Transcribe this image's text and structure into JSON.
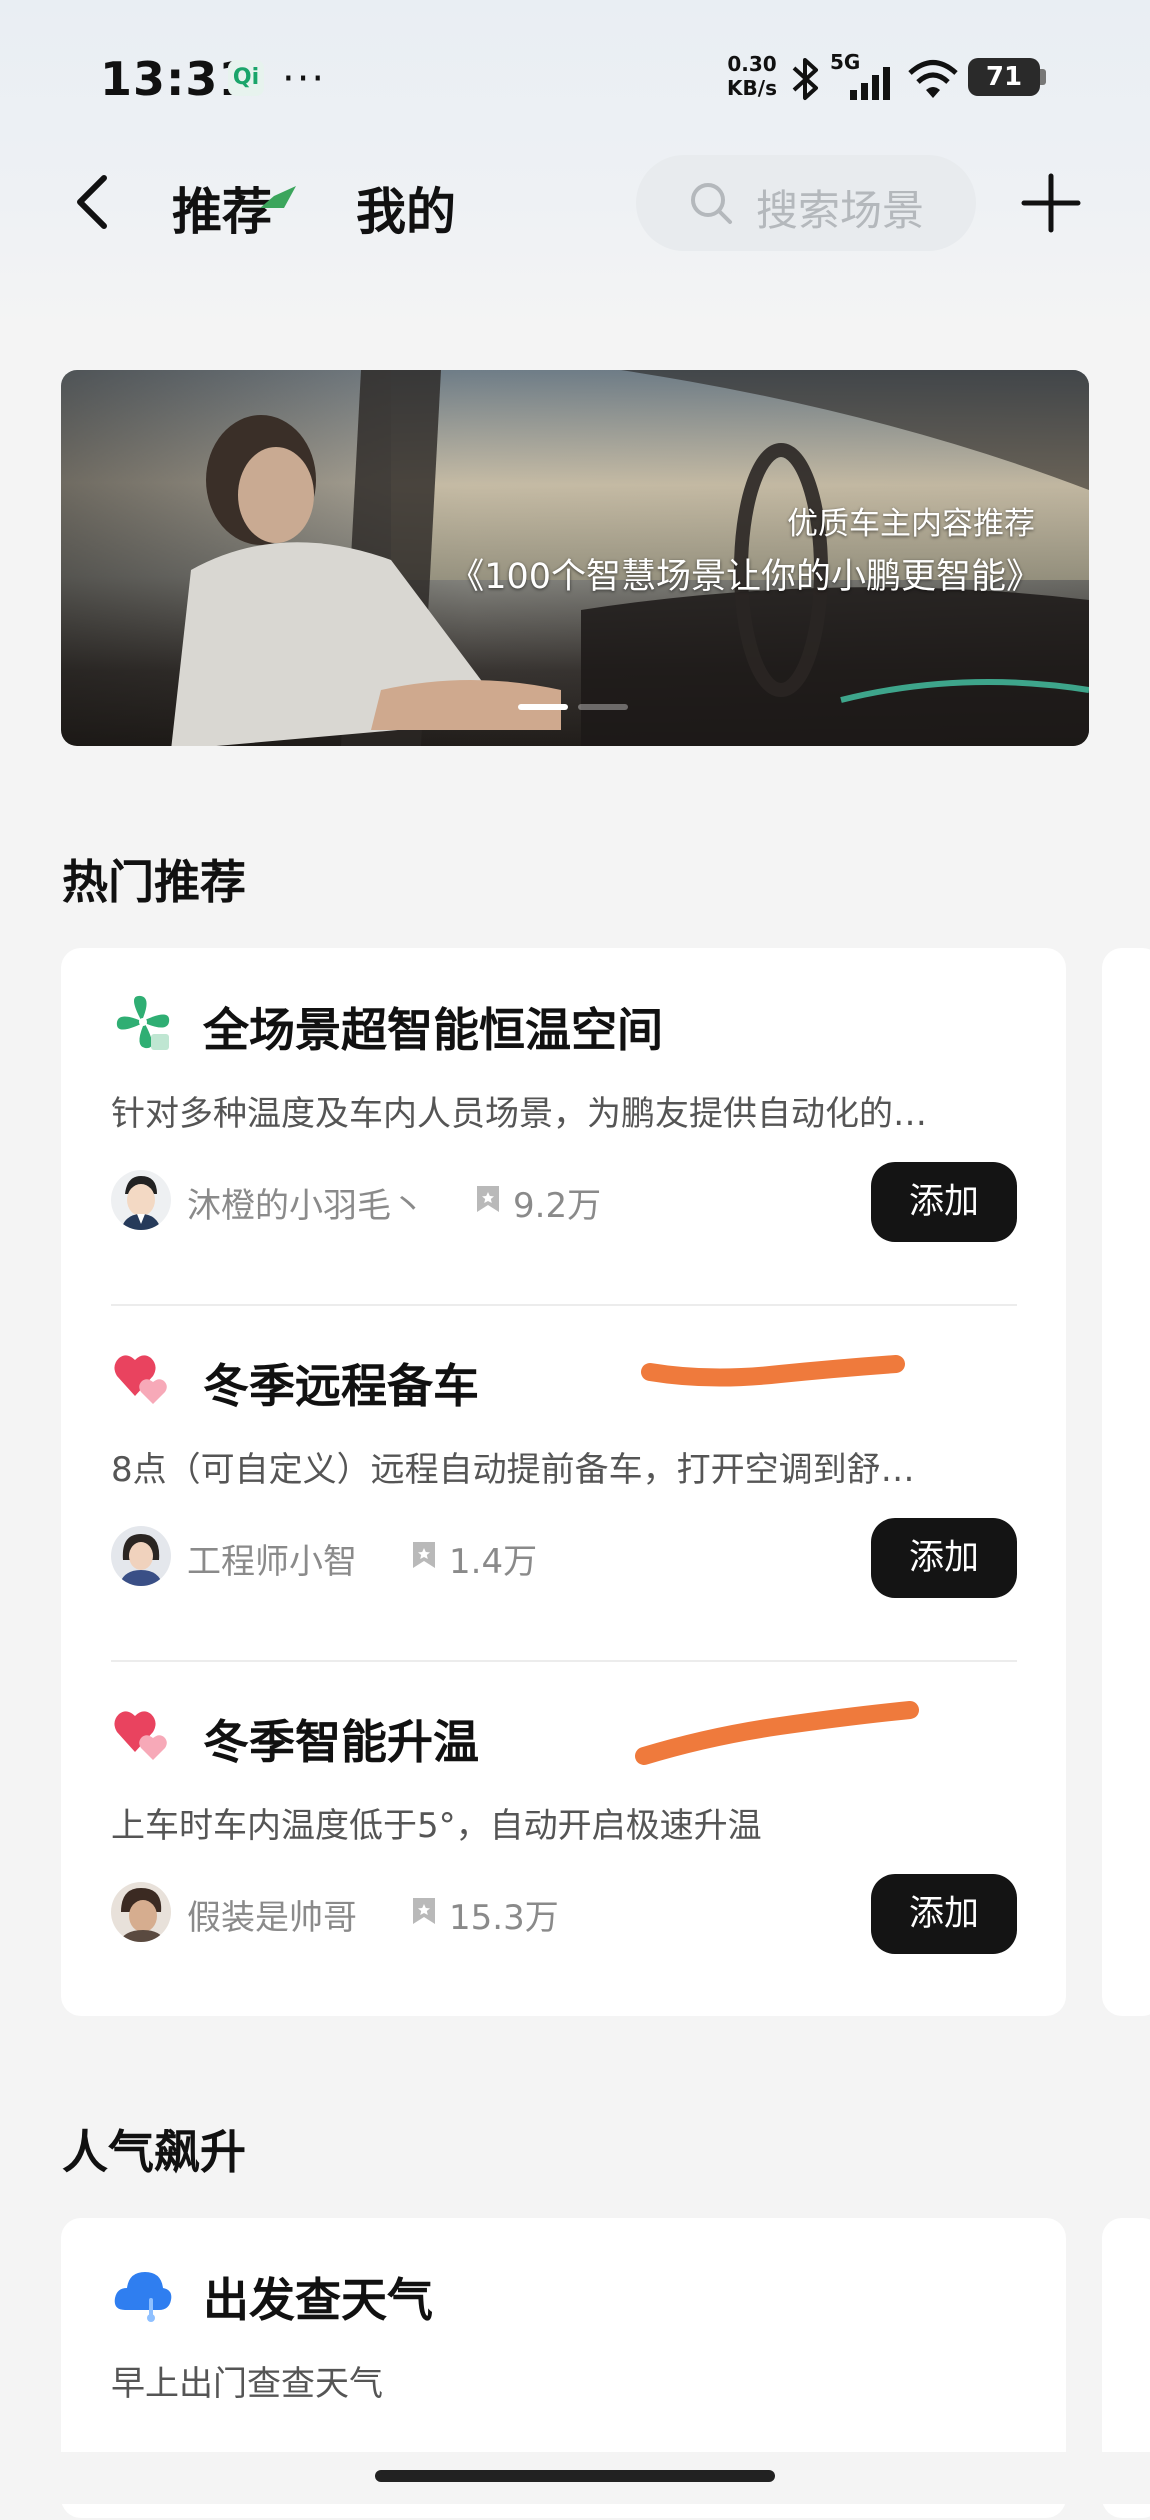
{
  "status_bar": {
    "time": "13:31",
    "app_icon_text": "Qi",
    "more": "···",
    "net_speed_value": "0.30",
    "net_speed_unit": "KB/s",
    "signal_label": "5G",
    "battery": "71"
  },
  "header": {
    "tabs": [
      {
        "label": "推荐",
        "active": true
      },
      {
        "label": "我的",
        "active": false
      }
    ],
    "search_placeholder": "搜索场景",
    "accent_color": "#3ba55c"
  },
  "banner": {
    "subtitle": "优质车主内容推荐",
    "title": "《100个智慧场景让你的小鹏更智能》",
    "slide_count": 2,
    "active_slide": 1
  },
  "sections": [
    {
      "title": "热门推荐",
      "items": [
        {
          "icon": "fan-icon",
          "title": "全场景超智能恒温空间",
          "desc": "针对多种温度及车内人员场景，为鹏友提供自动化的…",
          "author": "沐橙的小羽毛丶",
          "count": "9.2万",
          "button": "添加"
        },
        {
          "icon": "heart-icon",
          "title": "冬季远程备车",
          "desc": "8点（可自定义）远程自动提前备车，打开空调到舒…",
          "author": "工程师小智",
          "count": "1.4万",
          "button": "添加"
        },
        {
          "icon": "heart-icon",
          "title": "冬季智能升温",
          "desc": "上车时车内温度低于5°，自动开启极速升温",
          "author": "假装是帅哥",
          "count": "15.3万",
          "button": "添加"
        }
      ]
    },
    {
      "title": "人气飙升",
      "items": [
        {
          "icon": "cloud-icon",
          "title": "出发查天气",
          "desc": "早上出门查查天气"
        }
      ]
    }
  ],
  "colors": {
    "button_bg": "#141414",
    "scribble": "#ef7a3c",
    "page_bg": "#f4f4f4"
  }
}
